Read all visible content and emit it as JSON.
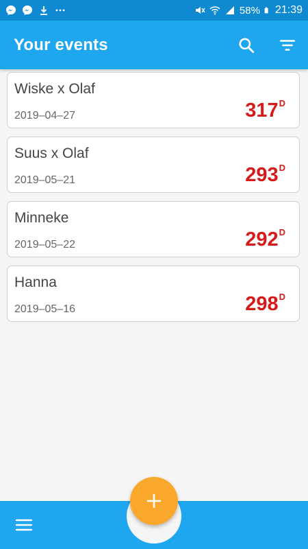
{
  "status_bar": {
    "left_icons": [
      "messenger-icon",
      "messenger-icon",
      "download-icon",
      "more-dots-icon"
    ],
    "battery": "58%",
    "time": "21:39"
  },
  "app_bar": {
    "title": "Your events",
    "actions": [
      "search-icon",
      "filter-icon"
    ]
  },
  "events": [
    {
      "name": "Wiske x Olaf",
      "date": "2019–04–27",
      "days": "317",
      "unit": "D"
    },
    {
      "name": "Suus x Olaf",
      "date": "2019–05–21",
      "days": "293",
      "unit": "D"
    },
    {
      "name": "Minneke",
      "date": "2019–05–22",
      "days": "292",
      "unit": "D"
    },
    {
      "name": "Hanna",
      "date": "2019–05–16",
      "days": "298",
      "unit": "D"
    }
  ],
  "colors": {
    "status_bar": "#0f89d0",
    "app_bar": "#1ea6ee",
    "days_text": "#d61a1a",
    "fab": "#f9a82c",
    "background": "#f5f5f5"
  },
  "bottom_bar": {
    "menu_icon": "hamburger-menu-icon",
    "fab_icon": "plus-icon"
  }
}
